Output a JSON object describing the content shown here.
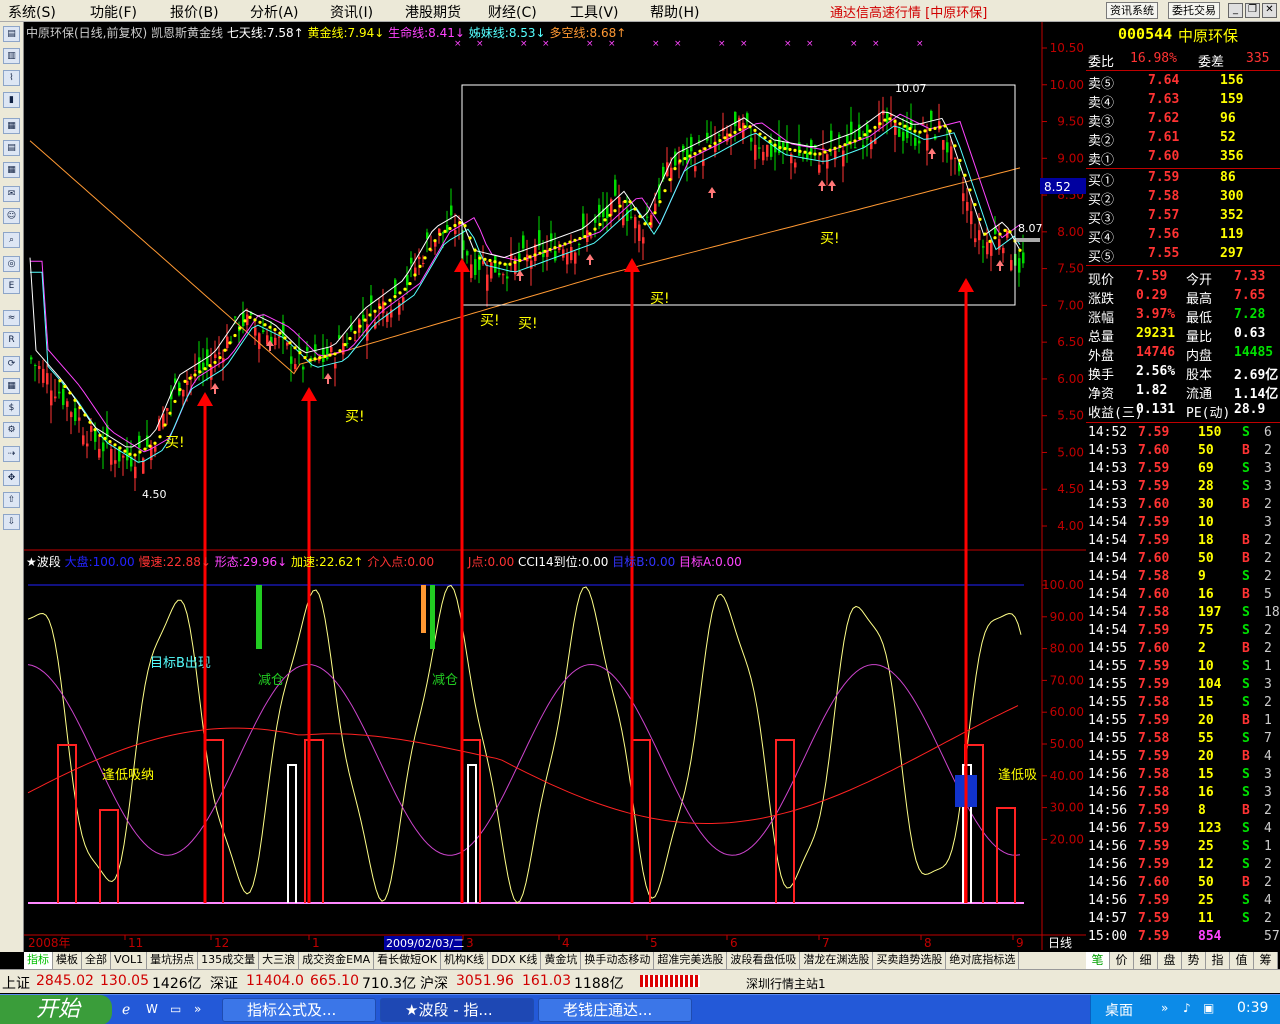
{
  "menu": [
    "系统(S)",
    "功能(F)",
    "报价(B)",
    "分析(A)",
    "资讯(I)",
    "港股期货",
    "财经(C)",
    "工具(V)",
    "帮助(H)"
  ],
  "app_title": "通达信高速行情 [中原环保]",
  "top_buttons": [
    "资讯系统",
    "委托交易"
  ],
  "price_info": {
    "title": "中原环保(日线,前复权) 凯恩斯黄金线",
    "seven": "七天线:7.58↑",
    "gold": "黄金线:7.94↓",
    "life": "生命线:8.41↓",
    "sister": "姊妹线:8.53↓",
    "multi": "多空线:8.68↑"
  },
  "ind_info": {
    "name": "★波段",
    "big": "大盘:100.00",
    "slow": "慢速:22.88↓",
    "shape": "形态:29.96↓",
    "acc": "加速:22.62↑",
    "entry": "介入点:0.00",
    "j": "J点:0.00",
    "cci": "CCI14到位:0.00",
    "tb": "目标B:0.00",
    "ta": "目标A:0.00"
  },
  "price_axis": [
    "10.50",
    "10.00",
    "9.50",
    "9.00",
    "8.50",
    "8.00",
    "7.50",
    "7.00",
    "6.50",
    "6.00",
    "5.50",
    "5.00",
    "4.50",
    "4.00"
  ],
  "ind_axis": [
    "100.00",
    "90.00",
    "80.00",
    "70.00",
    "60.00",
    "50.00",
    "40.00",
    "30.00",
    "20.00"
  ],
  "current_price_tag": "8.52",
  "marks": {
    "high": "10.07",
    "low": "4.50",
    "right": "8.07"
  },
  "annotations": {
    "buy": "买!",
    "target": "目标B出现",
    "reduce": "减仓",
    "low_absorb": "逢低吸纳",
    "low_absorb2": "逢低吸"
  },
  "date_axis": {
    "year": "2008年",
    "months": [
      "11",
      "12",
      "1",
      "3",
      "4",
      "5",
      "6",
      "7",
      "8",
      "9"
    ],
    "cursor": "2009/02/03/二",
    "period": "日线"
  },
  "bottom_tabs": [
    "指标",
    "模板",
    "全部",
    "VOL1",
    "量坑拐点",
    "135成交量",
    "大三浪",
    "成交资金EMA",
    "看长做短OK",
    "机构K线",
    "DDX K线",
    "黄金坑",
    "换手动态移动",
    "超准完美选股",
    "波段看盘低吸",
    "潜龙在渊选股",
    "买卖趋势选股",
    "绝对底指标选"
  ],
  "right_tabs": [
    "笔",
    "价",
    "细",
    "盘",
    "势",
    "指",
    "值",
    "筹"
  ],
  "stock": {
    "code": "000544",
    "name": "中原环保",
    "wb_label": "委比",
    "wb": "16.98%",
    "wc_label": "委差",
    "wc": "335"
  },
  "sells": [
    {
      "l": "卖⑤",
      "p": "7.64",
      "v": "156"
    },
    {
      "l": "卖④",
      "p": "7.63",
      "v": "159"
    },
    {
      "l": "卖③",
      "p": "7.62",
      "v": "96"
    },
    {
      "l": "卖②",
      "p": "7.61",
      "v": "52"
    },
    {
      "l": "卖①",
      "p": "7.60",
      "v": "356"
    }
  ],
  "buys": [
    {
      "l": "买①",
      "p": "7.59",
      "v": "86"
    },
    {
      "l": "买②",
      "p": "7.58",
      "v": "300"
    },
    {
      "l": "买③",
      "p": "7.57",
      "v": "352"
    },
    {
      "l": "买④",
      "p": "7.56",
      "v": "119"
    },
    {
      "l": "买⑤",
      "p": "7.55",
      "v": "297"
    }
  ],
  "quote": [
    {
      "a": "现价",
      "b": "7.59",
      "bc": "#ff3333",
      "c": "今开",
      "d": "7.33",
      "dc": "#ff3333"
    },
    {
      "a": "涨跌",
      "b": "0.29",
      "bc": "#ff3333",
      "c": "最高",
      "d": "7.65",
      "dc": "#ff3333"
    },
    {
      "a": "涨幅",
      "b": "3.97%",
      "bc": "#ff3333",
      "c": "最低",
      "d": "7.28",
      "dc": "#00e000"
    },
    {
      "a": "总量",
      "b": "29231",
      "bc": "#ffff00",
      "c": "量比",
      "d": "0.63",
      "dc": "#ffffff"
    },
    {
      "a": "外盘",
      "b": "14746",
      "bc": "#ff3333",
      "c": "内盘",
      "d": "14485",
      "dc": "#00e000"
    },
    {
      "a": "换手",
      "b": "2.56%",
      "bc": "#ffffff",
      "c": "股本",
      "d": "2.69亿",
      "dc": "#ffffff"
    },
    {
      "a": "净资",
      "b": "1.82",
      "bc": "#ffffff",
      "c": "流通",
      "d": "1.14亿",
      "dc": "#ffffff"
    },
    {
      "a": "收益(三)",
      "b": "0.131",
      "bc": "#ffffff",
      "c": "PE(动)",
      "d": "28.9",
      "dc": "#ffffff"
    }
  ],
  "ticks": [
    [
      "14:52",
      "7.59",
      "150",
      "S",
      "6"
    ],
    [
      "14:53",
      "7.60",
      "50",
      "B",
      "2"
    ],
    [
      "14:53",
      "7.59",
      "69",
      "S",
      "3"
    ],
    [
      "14:53",
      "7.59",
      "28",
      "S",
      "3"
    ],
    [
      "14:53",
      "7.60",
      "30",
      "B",
      "2"
    ],
    [
      "14:54",
      "7.59",
      "10",
      "",
      "3"
    ],
    [
      "14:54",
      "7.59",
      "18",
      "B",
      "2"
    ],
    [
      "14:54",
      "7.60",
      "50",
      "B",
      "2"
    ],
    [
      "14:54",
      "7.58",
      "9",
      "S",
      "2"
    ],
    [
      "14:54",
      "7.60",
      "16",
      "B",
      "5"
    ],
    [
      "14:54",
      "7.58",
      "197",
      "S",
      "18"
    ],
    [
      "14:54",
      "7.59",
      "75",
      "S",
      "2"
    ],
    [
      "14:55",
      "7.60",
      "2",
      "B",
      "2"
    ],
    [
      "14:55",
      "7.59",
      "10",
      "S",
      "1"
    ],
    [
      "14:55",
      "7.59",
      "104",
      "S",
      "3"
    ],
    [
      "14:55",
      "7.58",
      "15",
      "S",
      "2"
    ],
    [
      "14:55",
      "7.59",
      "20",
      "B",
      "1"
    ],
    [
      "14:55",
      "7.58",
      "55",
      "S",
      "7"
    ],
    [
      "14:55",
      "7.59",
      "20",
      "B",
      "4"
    ],
    [
      "14:56",
      "7.58",
      "15",
      "S",
      "3"
    ],
    [
      "14:56",
      "7.58",
      "16",
      "S",
      "3"
    ],
    [
      "14:56",
      "7.59",
      "8",
      "B",
      "2"
    ],
    [
      "14:56",
      "7.59",
      "123",
      "S",
      "4"
    ],
    [
      "14:56",
      "7.59",
      "25",
      "S",
      "1"
    ],
    [
      "14:56",
      "7.59",
      "12",
      "S",
      "2"
    ],
    [
      "14:56",
      "7.60",
      "50",
      "B",
      "2"
    ],
    [
      "14:56",
      "7.59",
      "25",
      "S",
      "4"
    ],
    [
      "14:57",
      "7.59",
      "11",
      "S",
      "2"
    ],
    [
      "15:00",
      "7.59",
      "854",
      "",
      "57"
    ]
  ],
  "status": {
    "sh_label": "上证",
    "sh": "2845.02",
    "sh_chg": "130.05",
    "sh_amt": "1426亿",
    "sz_label": "深证",
    "sz": "11404.0",
    "sz_chg": "665.10",
    "sz_amt": "710.3亿",
    "hs_label": "沪深",
    "hs": "3051.96",
    "hs_chg": "161.03",
    "hs_amt": "1188亿",
    "server": "深圳行情主站1"
  },
  "taskbar": {
    "start": "开始",
    "tasks": [
      "指标公式及...",
      "★波段 - 指...",
      "老钱庄通达..."
    ],
    "tray_label": "桌面",
    "time": "0:39"
  }
}
